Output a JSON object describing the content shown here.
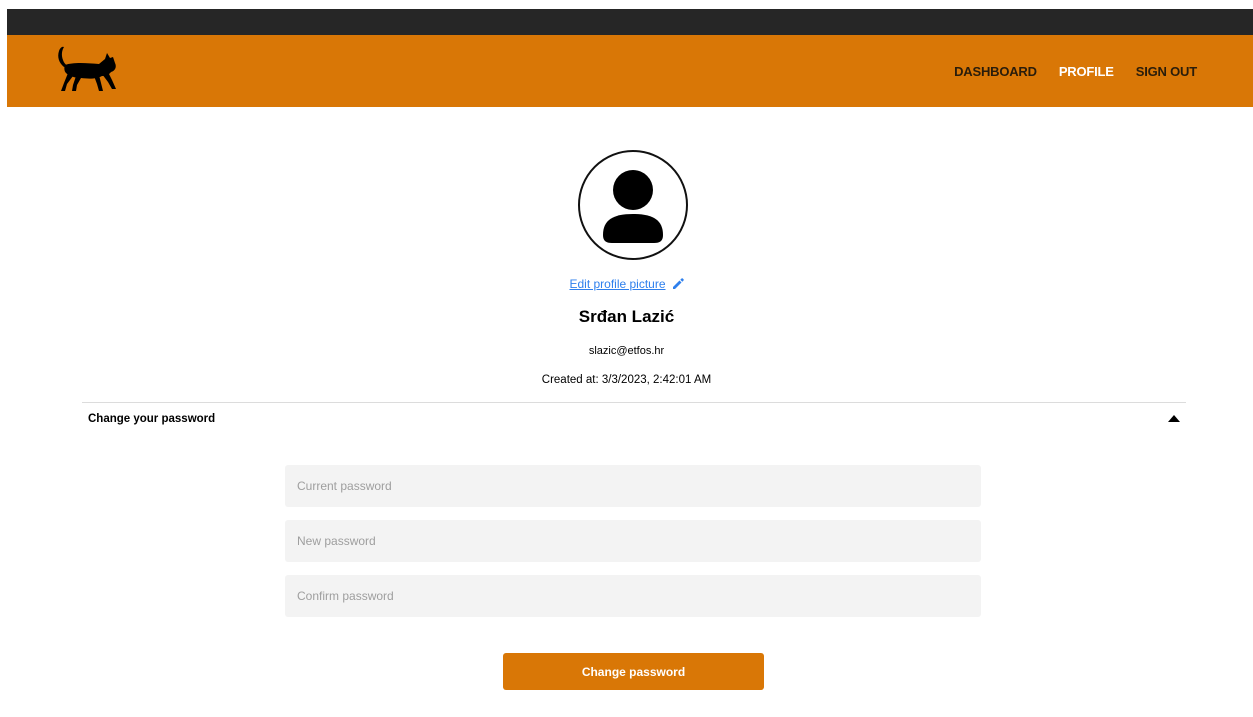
{
  "nav": {
    "logo_icon": "black-cat-icon",
    "links": [
      {
        "label": "DASHBOARD",
        "active": false
      },
      {
        "label": "PROFILE",
        "active": true
      },
      {
        "label": "SIGN OUT",
        "active": false
      }
    ]
  },
  "profile": {
    "avatar_icon": "user-avatar-icon",
    "edit_picture_label": "Edit profile picture",
    "edit_icon": "pencil-icon",
    "name": "Srđan Lazić",
    "email": "slazic@etfos.hr",
    "created_at": "Created at: 3/3/2023, 2:42:01 AM"
  },
  "password_section": {
    "title": "Change your password",
    "toggle_icon": "caret-up-icon",
    "fields": {
      "current_placeholder": "Current password",
      "current_value": "",
      "new_placeholder": "New password",
      "new_value": "",
      "confirm_placeholder": "Confirm password",
      "confirm_value": ""
    },
    "submit_label": "Change password"
  },
  "colors": {
    "brand": "#d97706",
    "top_strip": "#262626",
    "link": "#2f80ed",
    "field_bg": "#f3f3f3"
  }
}
